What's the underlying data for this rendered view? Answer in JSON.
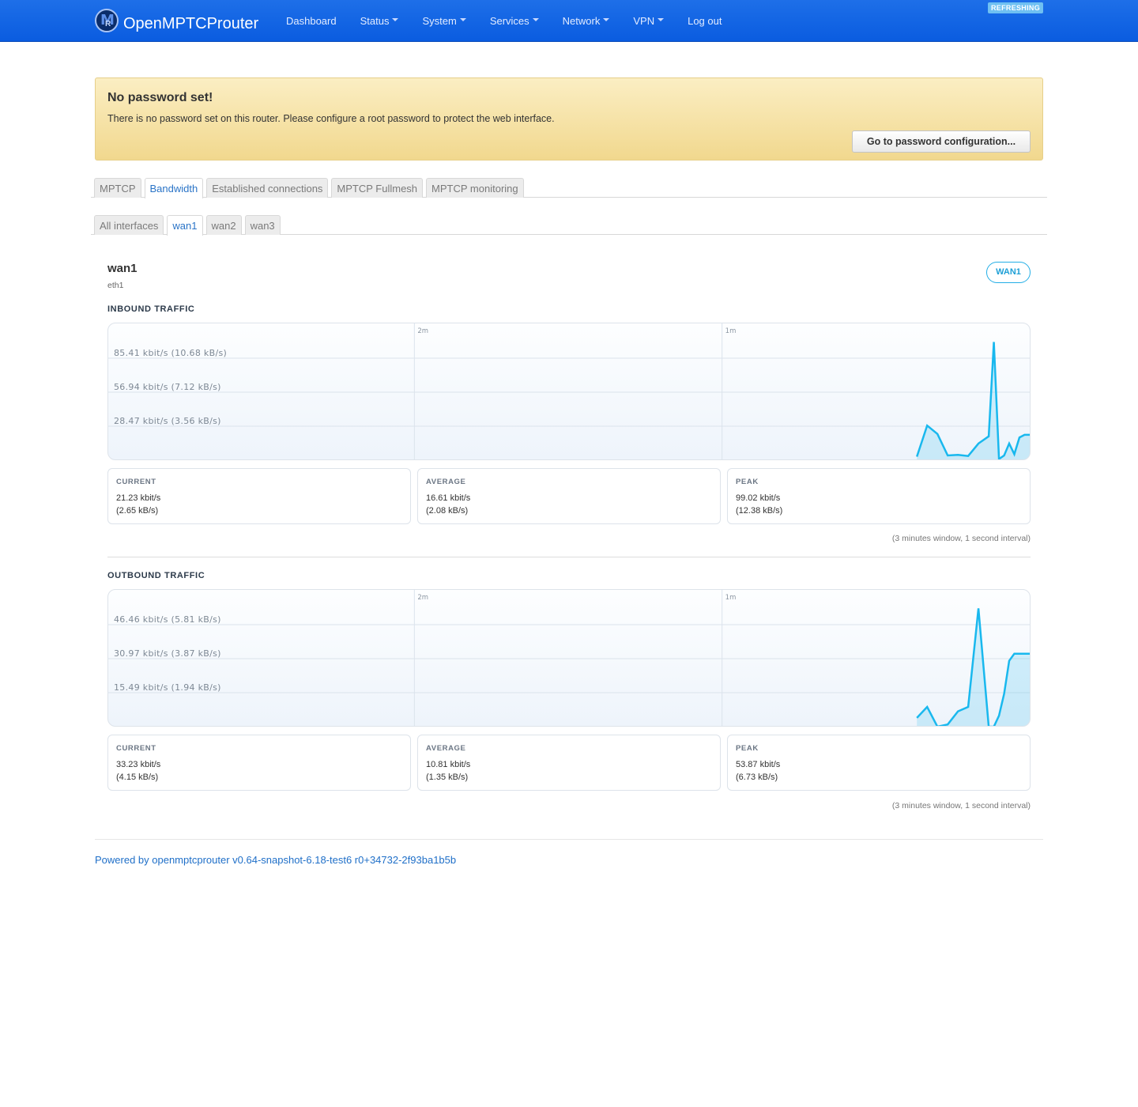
{
  "navbar": {
    "brand": "OpenMPTCProuter",
    "logo_letters": {
      "m": "M",
      "r": "R"
    },
    "items": [
      {
        "label": "Dashboard",
        "dropdown": false
      },
      {
        "label": "Status",
        "dropdown": true
      },
      {
        "label": "System",
        "dropdown": true
      },
      {
        "label": "Services",
        "dropdown": true
      },
      {
        "label": "Network",
        "dropdown": true
      },
      {
        "label": "VPN",
        "dropdown": true
      },
      {
        "label": "Log out",
        "dropdown": false
      }
    ],
    "refreshing_badge": "REFRESHING",
    "color": "#1366e6"
  },
  "alert": {
    "title": "No password set!",
    "message": "There is no password set on this router. Please configure a root password to protect the web interface.",
    "button": "Go to password configuration..."
  },
  "main_tabs": [
    {
      "label": "MPTCP",
      "active": false
    },
    {
      "label": "Bandwidth",
      "active": true
    },
    {
      "label": "Established connections",
      "active": false
    },
    {
      "label": "MPTCP Fullmesh",
      "active": false
    },
    {
      "label": "MPTCP monitoring",
      "active": false
    }
  ],
  "iface_tabs": [
    {
      "label": "All interfaces",
      "active": false
    },
    {
      "label": "wan1",
      "active": true
    },
    {
      "label": "wan2",
      "active": false
    },
    {
      "label": "wan3",
      "active": false
    }
  ],
  "interface": {
    "name": "wan1",
    "device": "eth1",
    "badge": "WAN1"
  },
  "inbound": {
    "title": "INBOUND TRAFFIC",
    "stats": {
      "current_label": "CURRENT",
      "current_1": "21.23 kbit/s",
      "current_2": "(2.65 kB/s)",
      "average_label": "AVERAGE",
      "average_1": "16.61 kbit/s",
      "average_2": "(2.08 kB/s)",
      "peak_label": "PEAK",
      "peak_1": "99.02 kbit/s",
      "peak_2": "(12.38 kB/s)"
    },
    "note": "(3 minutes window, 1 second interval)"
  },
  "outbound": {
    "title": "OUTBOUND TRAFFIC",
    "stats": {
      "current_label": "CURRENT",
      "current_1": "33.23 kbit/s",
      "current_2": "(4.15 kB/s)",
      "average_label": "AVERAGE",
      "average_1": "10.81 kbit/s",
      "average_2": "(1.35 kB/s)",
      "peak_label": "PEAK",
      "peak_1": "53.87 kbit/s",
      "peak_2": "(6.73 kB/s)"
    },
    "note": "(3 minutes window, 1 second interval)"
  },
  "chart_data": [
    {
      "type": "area",
      "title": "INBOUND TRAFFIC",
      "x_labels": [
        "2m",
        "1m"
      ],
      "y_tick_labels": [
        "85.41 kbit/s (10.68 kB/s)",
        "56.94 kbit/s (7.12 kB/s)",
        "28.47 kbit/s (3.56 kB/s)"
      ],
      "y_ticks": [
        85.41,
        56.94,
        28.47
      ],
      "ylim": [
        0,
        113.88
      ],
      "units": "kbit/s",
      "color": "#19b8ee",
      "x_seconds_ago": [
        22,
        20,
        18,
        16,
        14,
        12,
        10,
        8,
        7,
        6,
        5,
        4,
        3,
        2,
        1,
        0
      ],
      "values": [
        3,
        29,
        22,
        4,
        4.5,
        3.5,
        14,
        20,
        99,
        1,
        4,
        14,
        5,
        19,
        21.23,
        21.23
      ]
    },
    {
      "type": "area",
      "title": "OUTBOUND TRAFFIC",
      "x_labels": [
        "2m",
        "1m"
      ],
      "y_tick_labels": [
        "46.46 kbit/s (5.81 kB/s)",
        "30.97 kbit/s (3.87 kB/s)",
        "15.49 kbit/s (1.94 kB/s)"
      ],
      "y_ticks": [
        46.46,
        30.97,
        15.49
      ],
      "ylim": [
        0,
        61.95
      ],
      "units": "kbit/s",
      "color": "#19b8ee",
      "x_seconds_ago": [
        22,
        20,
        18,
        16,
        14,
        12,
        10,
        8,
        7,
        6,
        5,
        4,
        3,
        2,
        1,
        0
      ],
      "values": [
        4,
        9,
        0,
        1,
        7,
        9,
        53.87,
        0,
        0,
        5,
        15,
        30,
        33.23,
        33.23,
        33.23,
        33.23
      ]
    }
  ],
  "footer": "Powered by openmptcprouter v0.64-snapshot-6.18-test6 r0+34732-2f93ba1b5b"
}
